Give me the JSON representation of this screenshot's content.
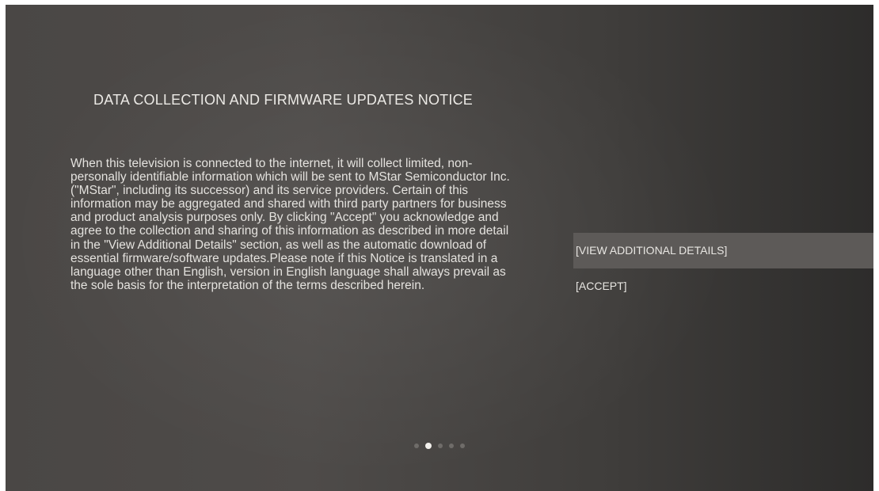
{
  "notice": {
    "title": "DATA COLLECTION AND FIRMWARE UPDATES NOTICE",
    "body": "When this television is connected to the internet, it will collect limited, non-personally identifiable information which will be sent to MStar Semiconductor Inc. (\"MStar\", including its successor) and its service providers. Certain of this information may be aggregated and shared with third party partners for business and product analysis purposes only. By clicking \"Accept\" you acknowledge and agree to the collection and sharing of this information as described in more detail in the \"View Additional Details\" section, as well as the automatic download of essential firmware/software updates.Please note if this Notice is translated in a language other than English, version in English language shall always prevail as the sole basis for the interpretation of the terms described herein."
  },
  "menu": {
    "items": [
      {
        "label": "[VIEW ADDITIONAL DETAILS]",
        "focused": true
      },
      {
        "label": "[ACCEPT]",
        "focused": false
      }
    ]
  },
  "pager": {
    "total_pages": 5,
    "current_page": 2
  },
  "colors": {
    "background_center": "#4e4b49",
    "background_edge": "#2d2c2b",
    "text": "#e6e4e0",
    "focus_highlight": "#5d5a58",
    "dot_inactive": "#6f6c69",
    "dot_active": "#f2f0ec"
  }
}
